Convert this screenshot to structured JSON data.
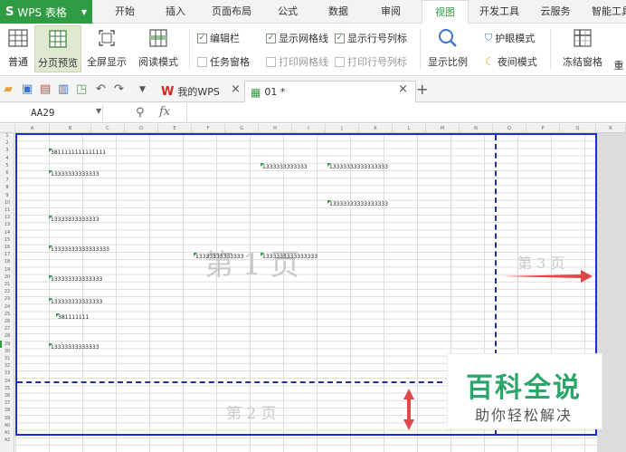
{
  "app": {
    "name": "WPS 表格",
    "logo": "S"
  },
  "menu": {
    "items": [
      "开始",
      "插入",
      "页面布局",
      "公式",
      "数据",
      "审阅",
      "视图",
      "开发工具",
      "云服务",
      "智能工具"
    ],
    "active": "视图"
  },
  "ribbon": {
    "normal": "普通",
    "page_break_preview": "分页预览",
    "fullscreen": "全屏显示",
    "reading_mode": "阅读模式",
    "edit_bar": "编辑栏",
    "task_pane": "任务窗格",
    "show_gridlines": "显示网格线",
    "print_gridlines": "打印网格线",
    "show_headers": "显示行号列标",
    "print_headers": "打印行号列标",
    "zoom": "显示比例",
    "eye_protect": "护眼模式",
    "night_mode": "夜间模式",
    "freeze": "冻结窗格",
    "rearrange": "重"
  },
  "tabs": {
    "wps": "我的WPS",
    "doc": "01 *"
  },
  "formula": {
    "name_box": "AA29",
    "fx": "fx"
  },
  "sheet": {
    "columns": [
      "A",
      "B",
      "C",
      "D",
      "E",
      "F",
      "G",
      "H",
      "I",
      "J",
      "K",
      "L",
      "M",
      "N",
      "O",
      "P",
      "Q",
      "R"
    ],
    "cells": {
      "b3": "3811111111111111",
      "h5": "1333333333333",
      "j5": "13333333333333333",
      "b6": "13333333333333",
      "j10": "13333333333333333",
      "b12": "13333333333333",
      "b16": "13333333333333333",
      "f17": "13333333333333",
      "h17": "1333333333333333",
      "b20": "133333333333333",
      "b23": "133333333333333",
      "c25": "381111111",
      "b29": "13333333333333"
    },
    "pages": {
      "p1": "第 1 页",
      "p2": "第 2 页",
      "p3": "第 3 页"
    }
  },
  "watermark": {
    "title": "百科全说",
    "subtitle": "助你轻松解决"
  },
  "colors": {
    "accent": "#2f9c43",
    "page_break": "#1a2fd0",
    "arrow": "#e04848"
  }
}
